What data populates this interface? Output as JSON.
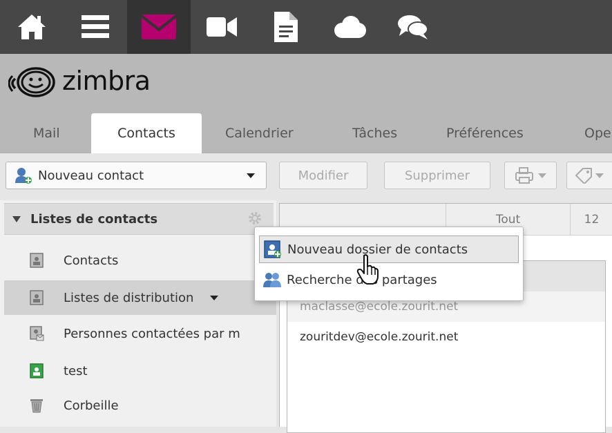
{
  "app_icons": [
    {
      "name": "home-icon",
      "active": false
    },
    {
      "name": "menu-icon",
      "active": false
    },
    {
      "name": "mail-icon",
      "active": true
    },
    {
      "name": "video-icon",
      "active": false
    },
    {
      "name": "document-icon",
      "active": false
    },
    {
      "name": "cloud-icon",
      "active": false
    },
    {
      "name": "chat-icon",
      "active": false
    }
  ],
  "logo": {
    "text": "zimbra"
  },
  "tabs": [
    {
      "label": "Mail"
    },
    {
      "label": "Contacts",
      "active": true
    },
    {
      "label": "Calendrier"
    },
    {
      "label": "Tâches"
    },
    {
      "label": "Préférences"
    },
    {
      "label": "Ope"
    }
  ],
  "toolbar": {
    "new_contact": "Nouveau contact",
    "edit": "Modifier",
    "delete": "Supprimer"
  },
  "sidebar": {
    "header": "Listes de contacts",
    "items": [
      {
        "label": "Contacts"
      },
      {
        "label": "Listes de distribution",
        "selected": true
      },
      {
        "label": "Personnes contactées par m"
      },
      {
        "label": "test"
      },
      {
        "label": "Corbeille"
      }
    ]
  },
  "alpha_tabs": {
    "all": "Tout",
    "num": "12"
  },
  "contacts": [
    {
      "email": "maclasse@ecole.zourit.net"
    },
    {
      "email": "zouritdev@ecole.zourit.net"
    }
  ],
  "context_menu": {
    "items": [
      {
        "label": "Nouveau dossier de contacts",
        "hover": true
      },
      {
        "label": "Recherche des partages"
      }
    ]
  },
  "colors": {
    "accent_mail": "#b5006e",
    "topbar": "#474747",
    "logobar": "#b8b8b8"
  }
}
